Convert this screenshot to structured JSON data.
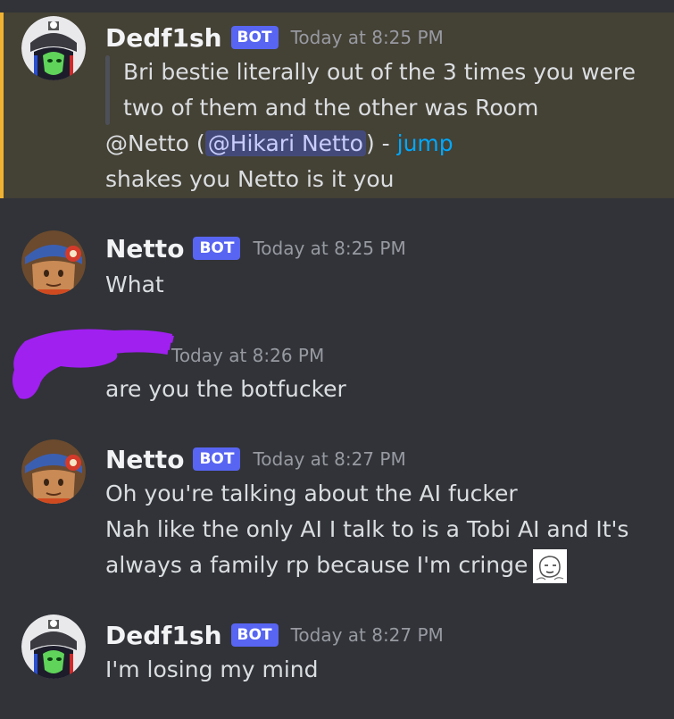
{
  "colors": {
    "background": "#313338",
    "highlight_background": "#444135",
    "highlight_bar": "#f0b232",
    "bot_tag": "#5865f2",
    "link": "#00a8fc",
    "mention_bg": "#434a7a",
    "mention_text": "#c9cdfb",
    "scribble": "#a020f0"
  },
  "messages": [
    {
      "author": "Dedf1sh",
      "bot_tag": "BOT",
      "timestamp": "Today at 8:25 PM",
      "avatar_icon": "green-masked-character-avatar",
      "highlighted": true,
      "quote": [
        "Bri bestie literally out of the 3 times you were",
        "two of them and the other was Room"
      ],
      "reply_prefix": "@Netto (",
      "mention": "@Hikari Netto",
      "reply_suffix": ") - ",
      "jump_label": "jump",
      "body": "shakes you Netto is it you"
    },
    {
      "author": "Netto",
      "bot_tag": "BOT",
      "timestamp": "Today at 8:25 PM",
      "avatar_icon": "netto-headband-avatar",
      "body": "What"
    },
    {
      "author_redacted": true,
      "timestamp": "Today at 8:26 PM",
      "body": "are you the botfucker"
    },
    {
      "author": "Netto",
      "bot_tag": "BOT",
      "timestamp": "Today at 8:27 PM",
      "avatar_icon": "netto-headband-avatar",
      "lines": [
        "Oh you're talking about the AI fucker",
        "Nah like the only AI I talk to is a Tobi AI and It's",
        "always a family rp because I'm cringe"
      ],
      "emoji": "sketch-face-emoji"
    },
    {
      "author": "Dedf1sh",
      "bot_tag": "BOT",
      "timestamp": "Today at 8:27 PM",
      "avatar_icon": "green-masked-character-avatar",
      "body": "I'm losing my mind"
    }
  ]
}
